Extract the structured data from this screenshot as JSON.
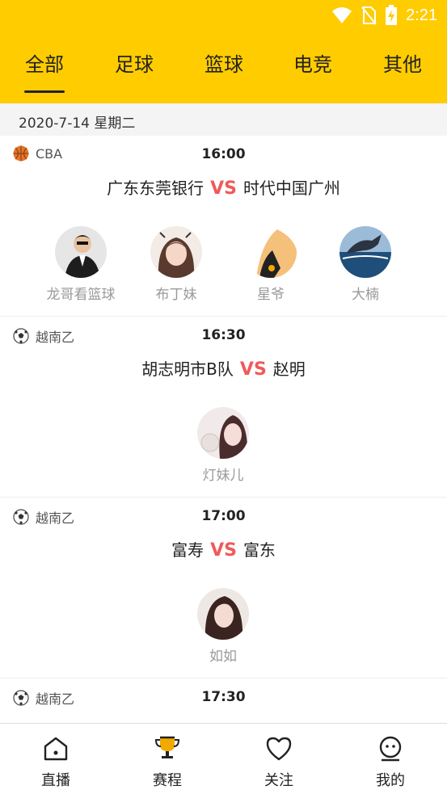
{
  "status": {
    "time": "2:21"
  },
  "tabs": [
    {
      "label": "全部",
      "active": true
    },
    {
      "label": "足球"
    },
    {
      "label": "篮球"
    },
    {
      "label": "电竞"
    },
    {
      "label": "其他"
    }
  ],
  "date": "2020-7-14 星期二",
  "vs_text": "VS",
  "matches": [
    {
      "league": "CBA",
      "league_icon": "basketball-icon",
      "time": "16:00",
      "home": "广东东莞银行",
      "away": "时代中国广州",
      "streamers": [
        "龙哥看篮球",
        "布丁妹",
        "星爷",
        "大楠"
      ]
    },
    {
      "league": "越南乙",
      "league_icon": "soccer-ball-icon",
      "time": "16:30",
      "home": "胡志明市B队",
      "away": "赵明",
      "streamers": [
        "灯妹儿"
      ]
    },
    {
      "league": "越南乙",
      "league_icon": "soccer-ball-icon",
      "time": "17:00",
      "home": "富寿",
      "away": "富东",
      "streamers": [
        "如如"
      ]
    },
    {
      "league": "越南乙",
      "league_icon": "soccer-ball-icon",
      "time": "17:30"
    }
  ],
  "nav": [
    {
      "label": "直播",
      "icon": "home-icon"
    },
    {
      "label": "赛程",
      "icon": "trophy-icon",
      "active": true
    },
    {
      "label": "关注",
      "icon": "heart-icon"
    },
    {
      "label": "我的",
      "icon": "profile-icon"
    }
  ],
  "colors": {
    "header": "#FFCC00",
    "vs": "#F05A5A",
    "accent": "#F2A900"
  }
}
